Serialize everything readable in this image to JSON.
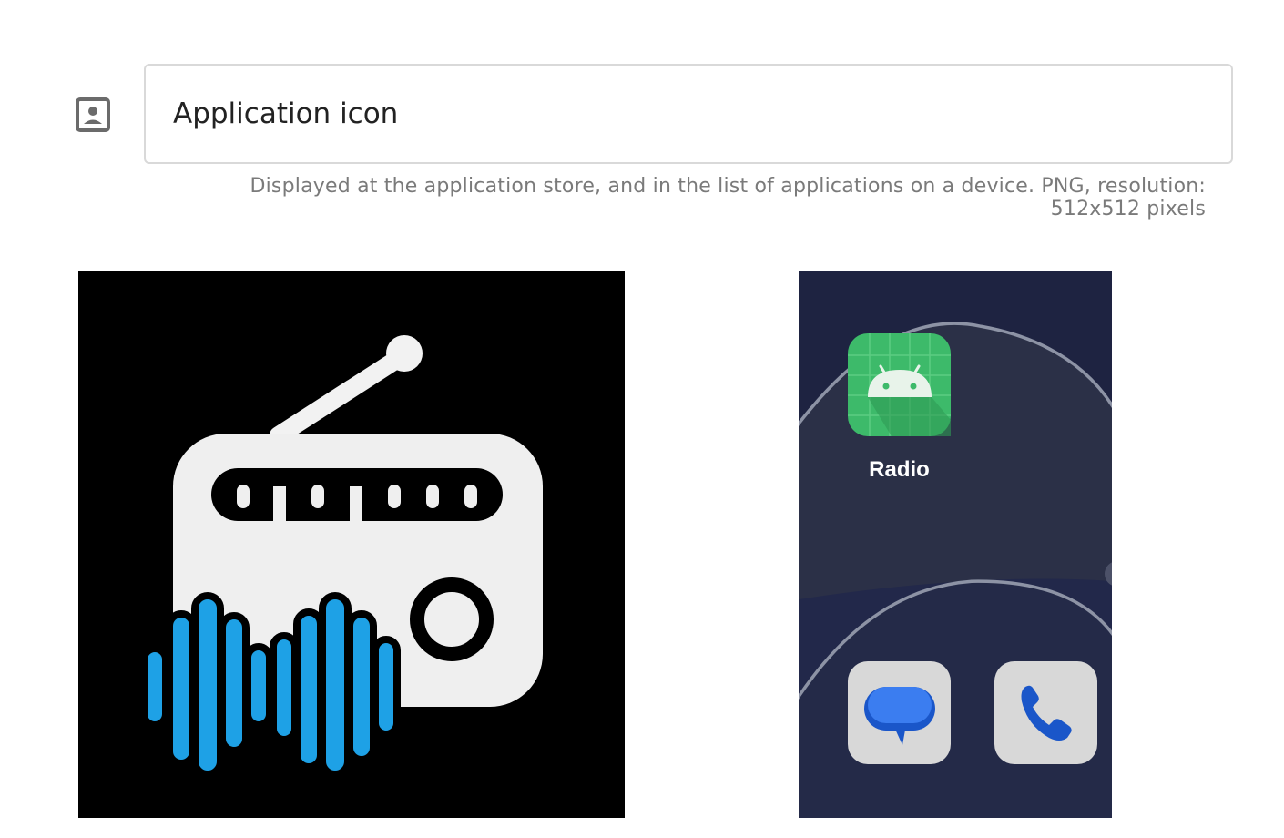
{
  "field": {
    "icon": "portrait-icon",
    "value": "Application icon",
    "hint": "Displayed at the application store, and in the list of applications on a device. PNG, resolution: 512x512 pixels"
  },
  "preview": {
    "icon_image": "radio-soundwave-icon",
    "phone": {
      "app_label": "Radio",
      "app_icon": "android-icon",
      "dock": [
        "messages-icon",
        "phone-icon"
      ]
    }
  },
  "colors": {
    "wave_blue": "#1ea1e6",
    "phone_bg": "#22284a",
    "android_green": "#3dba6a"
  }
}
